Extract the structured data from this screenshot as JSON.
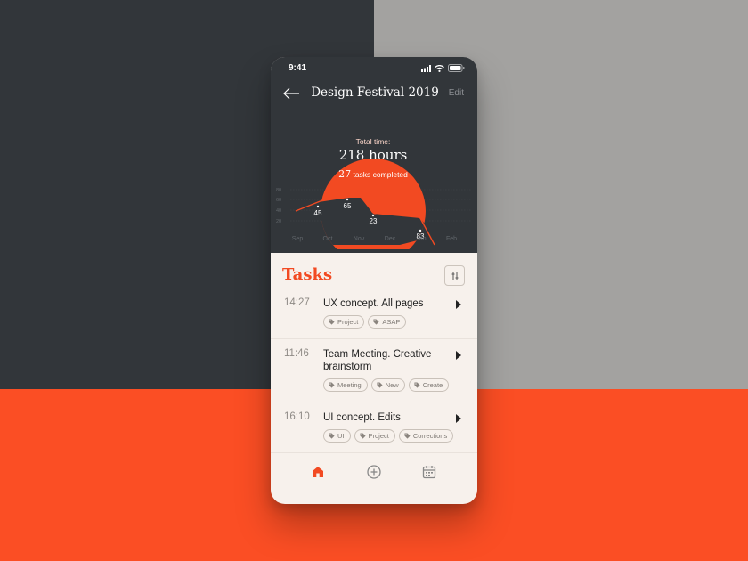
{
  "colors": {
    "accent": "#f24a22",
    "dark": "#32363a",
    "light_bg": "#f7f1ec"
  },
  "status": {
    "time": "9:41"
  },
  "nav": {
    "title": "Design Festival 2019",
    "edit": "Edit"
  },
  "summary": {
    "label": "Total time:",
    "hours": "218 hours",
    "tasks_count": "27",
    "tasks_text": "tasks completed"
  },
  "chart_data": {
    "type": "line",
    "categories": [
      "Sep",
      "Oct",
      "Nov",
      "Dec",
      "Jan",
      "Feb"
    ],
    "y_ticks": [
      "80",
      "60",
      "40",
      "20"
    ],
    "point_labels": [
      "45",
      "65",
      "23",
      "83"
    ],
    "grid": true,
    "highlight": "total time circle"
  },
  "tasks": {
    "title": "Tasks",
    "items": [
      {
        "time": "14:27",
        "title": "UX concept. All pages",
        "tags": [
          "Project",
          "ASAP"
        ]
      },
      {
        "time": "11:46",
        "title": "Team Meeting. Creative brainstorm",
        "tags": [
          "Meeting",
          "New",
          "Create"
        ]
      },
      {
        "time": "16:10",
        "title": "UI concept. Edits",
        "tags": [
          "UI",
          "Project",
          "Corrections"
        ]
      }
    ]
  },
  "tabbar": {
    "icons": [
      "home-icon",
      "add-icon",
      "calendar-icon"
    ]
  }
}
